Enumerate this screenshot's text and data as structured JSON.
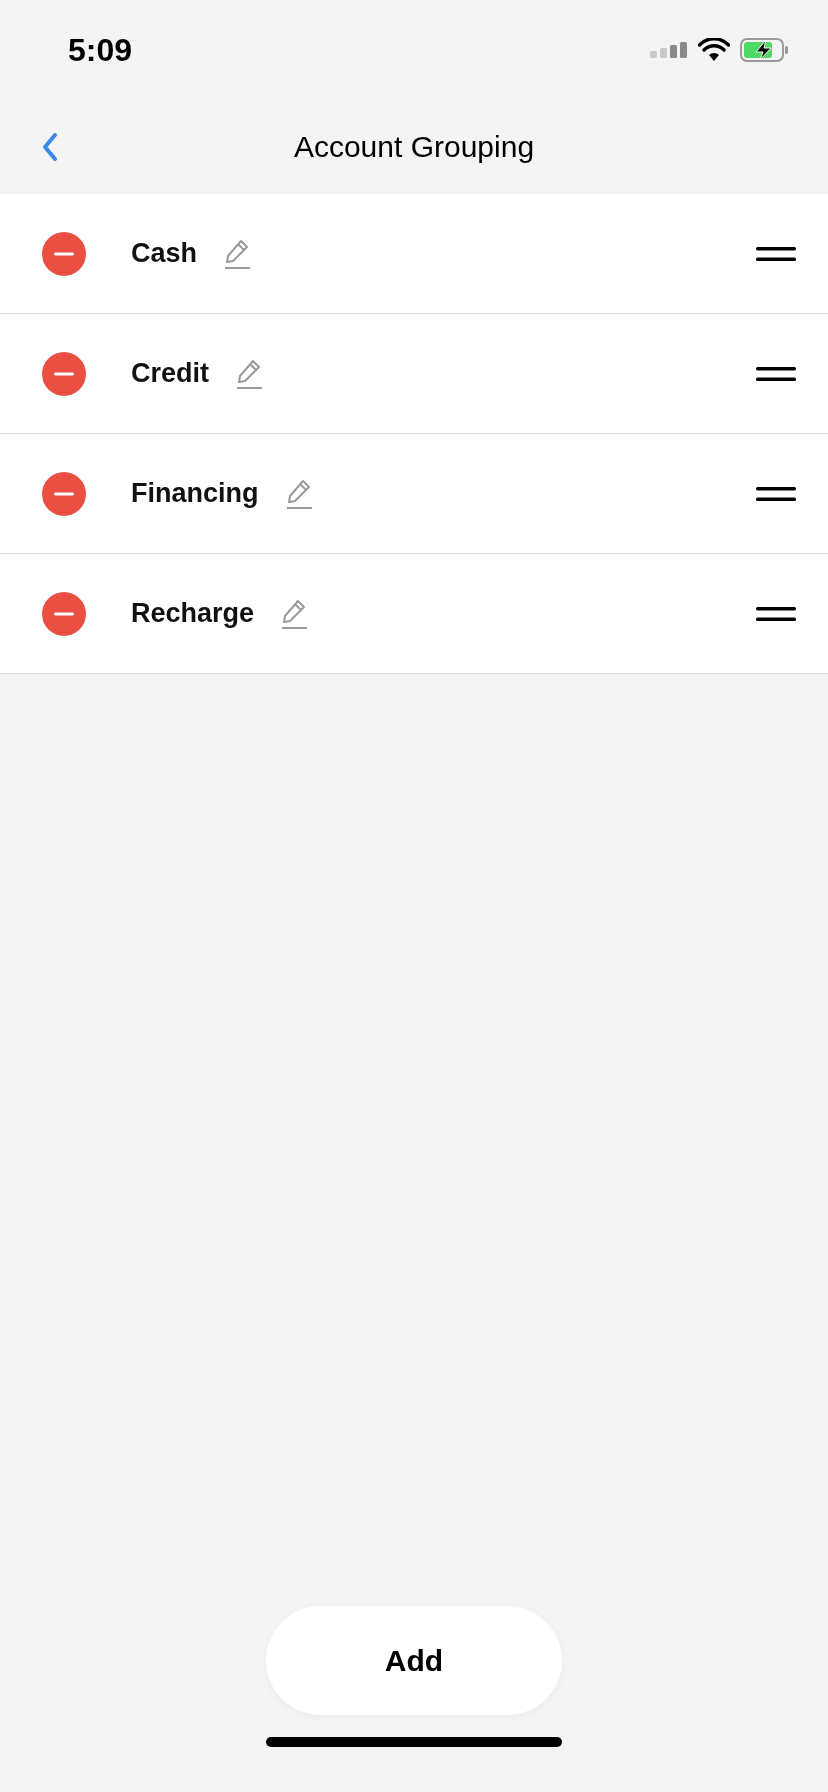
{
  "status_bar": {
    "time": "5:09"
  },
  "nav": {
    "title": "Account Grouping"
  },
  "groups": [
    {
      "name": "Cash"
    },
    {
      "name": "Credit"
    },
    {
      "name": "Financing"
    },
    {
      "name": "Recharge"
    }
  ],
  "add_button": {
    "label": "Add"
  }
}
